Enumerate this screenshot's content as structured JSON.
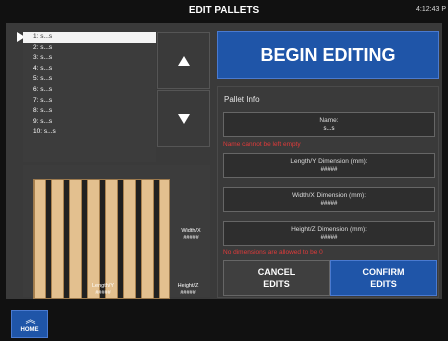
{
  "header": {
    "title": "EDIT PALLETS",
    "clock": "4:12:43 P"
  },
  "list": {
    "items": [
      "1: s...s",
      "2: s...s",
      "3: s...s",
      "4: s...s",
      "5: s...s",
      "6: s...s",
      "7: s...s",
      "8: s...s",
      "9: s...s",
      "10: s...s"
    ],
    "selected_index": 0
  },
  "pallet": {
    "width_label": "Width/X",
    "width_value": "#####",
    "length_label": "Length/Y",
    "length_value": "#####",
    "height_label": "Height/Z",
    "height_value": "#####"
  },
  "begin_editing_label": "BEGIN EDITING",
  "info": {
    "title": "Pallet Info",
    "name": {
      "label": "Name:",
      "value": "s...s"
    },
    "name_error": "Name cannot be left empty",
    "length": {
      "label": "Length/Y Dimension (mm):",
      "value": "#####"
    },
    "width": {
      "label": "Width/X Dimension (mm):",
      "value": "#####"
    },
    "height": {
      "label": "Height/Z Dimension (mm):",
      "value": "#####"
    },
    "dim_error": "No dimensions are allowed to be 0",
    "cancel_line1": "CANCEL",
    "cancel_line2": "EDITS",
    "confirm_line1": "CONFIRM",
    "confirm_line2": "EDITS"
  },
  "home": {
    "label": "HOME",
    "icon": "double-chevron-up-icon"
  },
  "colors": {
    "accent": "#1f55a8",
    "error": "#e03a3a",
    "panel": "#3a3a3a",
    "background": "#111111"
  }
}
